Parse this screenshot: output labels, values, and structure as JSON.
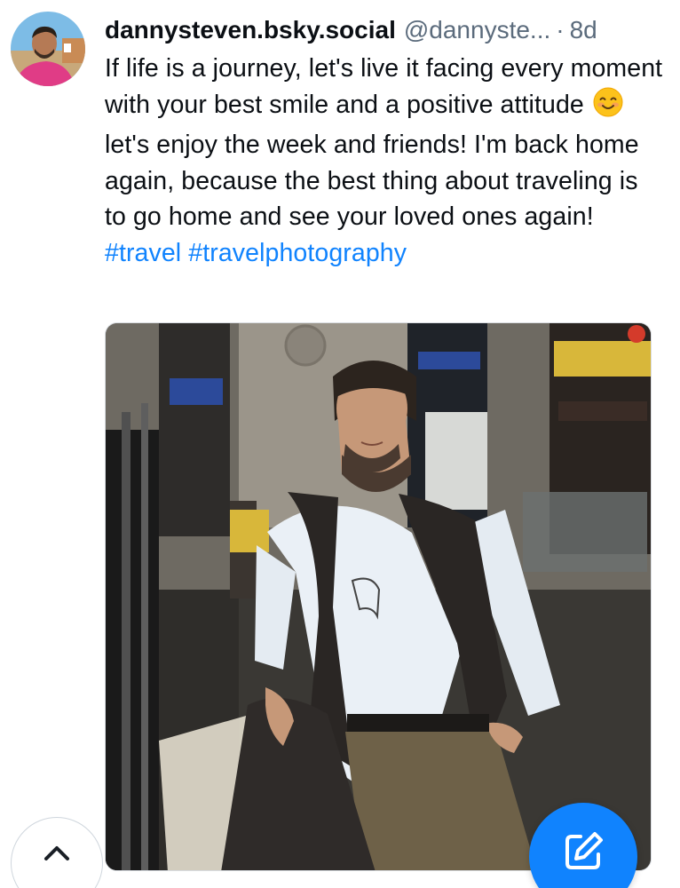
{
  "post": {
    "display_name": "dannysteven.bsky.social",
    "handle": "@dannyste...",
    "separator": "·",
    "timestamp": "8d",
    "text_before_emoji": "If life is a journey, let's live it facing every moment with your best smile and a positive attitude",
    "emoji": "smiling-face-with-smiling-eyes",
    "text_after_emoji": "let's enjoy the week and friends! I'm back home again, because the best thing about traveling is to go home and see your loved ones again!",
    "hashtags": [
      "#travel",
      "#travelphotography"
    ],
    "image": "photo-man-in-train-station"
  },
  "controls": {
    "scroll_top_icon": "chevron-up-icon",
    "compose_icon": "compose-icon"
  },
  "colors": {
    "accent": "#1083fe",
    "text": "#0b0f14",
    "muted": "#5b6b7c"
  }
}
